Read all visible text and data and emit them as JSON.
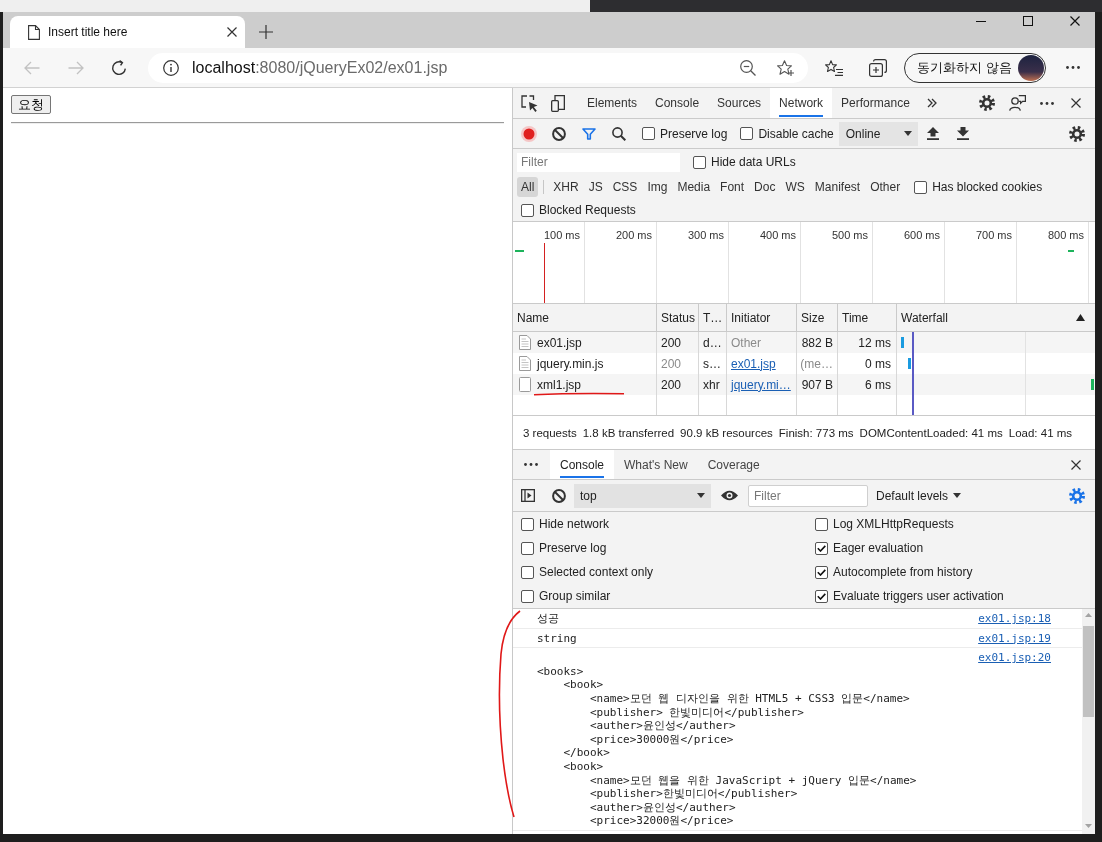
{
  "browser": {
    "tabs": [
      {
        "title": "Insert title here",
        "selected": true
      }
    ],
    "address": {
      "host": "localhost",
      "rest": ":8080/jQueryEx02/ex01.jsp"
    },
    "profile_button": "동기화하지 않음"
  },
  "page": {
    "button": "요청"
  },
  "devtools": {
    "tabs": [
      {
        "label": "Elements",
        "selected": false
      },
      {
        "label": "Console",
        "selected": false
      },
      {
        "label": "Sources",
        "selected": false
      },
      {
        "label": "Network",
        "selected": true
      },
      {
        "label": "Performance",
        "selected": false
      }
    ],
    "network": {
      "recording": true,
      "options": [
        {
          "label": "Preserve log",
          "checked": false
        },
        {
          "label": "Disable cache",
          "checked": false
        }
      ],
      "throttling": "Online",
      "filter": {
        "placeholder": "Filter"
      },
      "hide_data_urls": {
        "label": "Hide data URLs",
        "checked": false
      },
      "types": [
        {
          "label": "All",
          "selected": true
        },
        {
          "label": "XHR",
          "selected": false
        },
        {
          "label": "JS",
          "selected": false
        },
        {
          "label": "CSS",
          "selected": false
        },
        {
          "label": "Img",
          "selected": false
        },
        {
          "label": "Media",
          "selected": false
        },
        {
          "label": "Font",
          "selected": false
        },
        {
          "label": "Doc",
          "selected": false
        },
        {
          "label": "WS",
          "selected": false
        },
        {
          "label": "Manifest",
          "selected": false
        },
        {
          "label": "Other",
          "selected": false
        }
      ],
      "has_blocked_cookies": {
        "label": "Has blocked cookies",
        "checked": false
      },
      "blocked_requests": {
        "label": "Blocked Requests",
        "checked": false
      },
      "overview": {
        "ticks": [
          "100 ms",
          "200 ms",
          "300 ms",
          "400 ms",
          "500 ms",
          "600 ms",
          "700 ms",
          "800 ms"
        ]
      },
      "table": {
        "columns": [
          {
            "label": "Name",
            "sorted": false
          },
          {
            "label": "Status",
            "sorted": false
          },
          {
            "label": "T…",
            "sorted": false
          },
          {
            "label": "Initiator",
            "sorted": false
          },
          {
            "label": "Size",
            "sorted": false
          },
          {
            "label": "Time",
            "sorted": false
          },
          {
            "label": "Waterfall",
            "sorted": true
          }
        ],
        "rows": [
          {
            "kind": "document",
            "name": "ex01.jsp",
            "status": "200",
            "type": "d…",
            "initiator": {
              "text": "Other",
              "link": false
            },
            "size": "882 B",
            "time": "12 ms",
            "cached": false
          },
          {
            "kind": "document",
            "name": "jquery.min.js",
            "status": "200",
            "type": "s…",
            "initiator": {
              "text": "ex01.jsp",
              "link": true
            },
            "size": "(me…",
            "time": "0 ms",
            "cached": true
          },
          {
            "kind": "xhr",
            "name": "xml1.jsp",
            "status": "200",
            "type": "xhr",
            "initiator": {
              "text": "jquery.mi…",
              "link": true
            },
            "size": "907 B",
            "time": "6 ms",
            "cached": false
          }
        ]
      },
      "summary": [
        "3 requests",
        "1.8 kB transferred",
        "90.9 kB resources",
        "Finish: 773 ms",
        "DOMContentLoaded: 41 ms",
        "Load: 41 ms"
      ]
    },
    "drawer": {
      "tabs": [
        {
          "label": "Console",
          "selected": true
        },
        {
          "label": "What's New",
          "selected": false
        },
        {
          "label": "Coverage",
          "selected": false
        }
      ],
      "console": {
        "context": "top",
        "filter": {
          "placeholder": "Filter"
        },
        "levels": "Default levels",
        "left_settings": [
          {
            "label": "Hide network",
            "checked": false
          },
          {
            "label": "Preserve log",
            "checked": false
          },
          {
            "label": "Selected context only",
            "checked": false
          },
          {
            "label": "Group similar",
            "checked": false
          }
        ],
        "right_settings": [
          {
            "label": "Log XMLHttpRequests",
            "checked": false
          },
          {
            "label": "Eager evaluation",
            "checked": true
          },
          {
            "label": "Autocomplete from history",
            "checked": true
          },
          {
            "label": "Evaluate triggers user activation",
            "checked": true
          }
        ],
        "messages": [
          {
            "text": "성공",
            "source": "ex01.jsp:18"
          },
          {
            "text": "string",
            "source": "ex01.jsp:19"
          },
          {
            "text": "\n<books>\n    <book>\n        <name>모던 웹 디자인을 위한 HTML5 + CSS3 입문</name>\n        <publisher> 한빛미디어</publisher>\n        <auther>윤인성</auther>\n        <price>30000원</price>\n    </book>\n    <book>\n        <name>모던 웹을 위한 JavaScript + jQuery 입문</name>\n        <publisher>한빛미디어</publisher>\n        <auther>윤인성</auther>\n        <price>32000원</price>",
            "source": "ex01.jsp:20"
          }
        ]
      }
    }
  }
}
